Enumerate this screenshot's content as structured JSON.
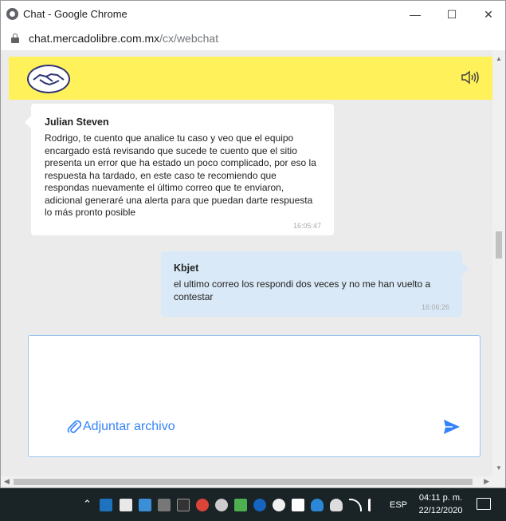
{
  "window": {
    "title": "Chat - Google Chrome",
    "controls": {
      "minimize": "—",
      "maximize": "☐",
      "close": "✕"
    }
  },
  "addressbar": {
    "domain": "chat.mercadolibre.com.mx",
    "path": "/cx/webchat"
  },
  "header": {
    "logo_icon": "mercadolibre-handshake-icon",
    "speaker_icon": "speaker-icon",
    "brand_color": "#fff159"
  },
  "messages": [
    {
      "sender": "Julian Steven",
      "text": "Rodrigo, te cuento que analice tu caso y veo que el equipo encargado está revisando que sucede te cuento que el sitio presenta un error que ha estado un poco complicado, por eso la respuesta ha tardado, en este caso te recomiendo que respondas nuevamente el último correo que te enviaron, adicional generaré una alerta para que puedan darte respuesta lo más pronto posible",
      "time": "16:05:47",
      "side": "left"
    },
    {
      "sender": "Kbjet",
      "text": "el ultimo correo los respondi dos veces y no me han vuelto a contestar",
      "time": "16:06:26",
      "side": "right"
    }
  ],
  "composer": {
    "placeholder": "",
    "attach_label": "Adjuntar archivo",
    "accent_color": "#3483fa"
  },
  "taskbar": {
    "language": "ESP",
    "time": "04:11 p. m.",
    "date": "22/12/2020"
  }
}
